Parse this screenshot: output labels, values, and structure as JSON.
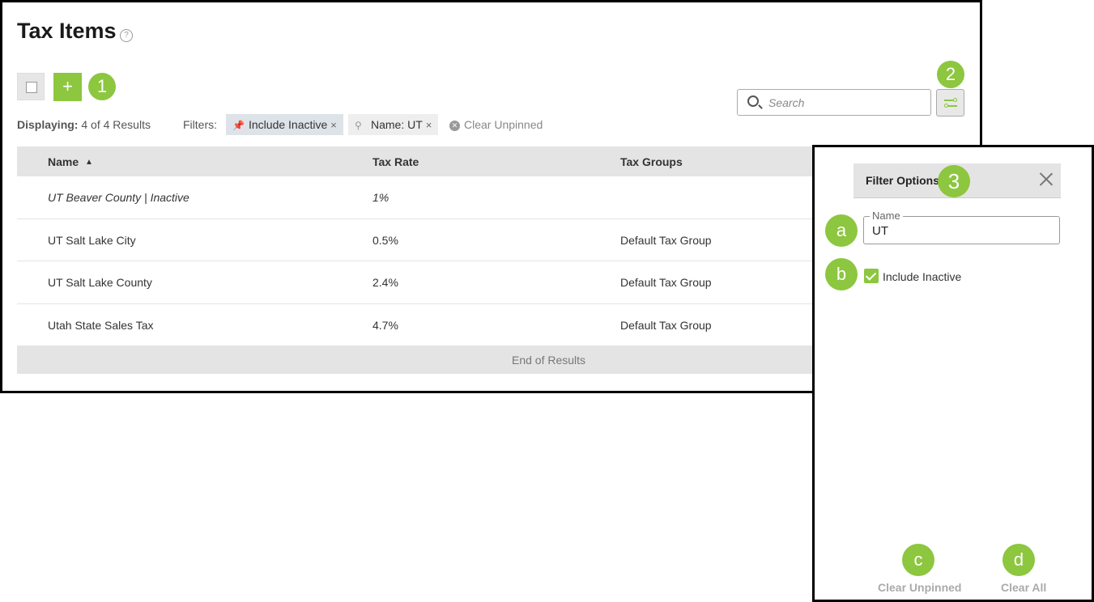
{
  "page": {
    "title": "Tax Items",
    "help": "?"
  },
  "toolbar": {
    "add_label": "+"
  },
  "summary": {
    "label": "Displaying:",
    "value": "4 of 4 Results"
  },
  "filters": {
    "label": "Filters:",
    "chips": [
      {
        "text": "Include Inactive",
        "pinned": true,
        "remove": "×"
      },
      {
        "text": "Name: UT",
        "pinned": false,
        "remove": "×"
      }
    ],
    "clear_unpinned": "Clear Unpinned"
  },
  "search": {
    "placeholder": "Search"
  },
  "table": {
    "columns": [
      "Name",
      "Tax Rate",
      "Tax Groups"
    ],
    "sort_indicator": "▲",
    "rows": [
      {
        "name": "UT Beaver County | Inactive",
        "rate": "1%",
        "groups": "",
        "inactive": true
      },
      {
        "name": "UT Salt Lake City",
        "rate": "0.5%",
        "groups": "Default Tax Group",
        "inactive": false
      },
      {
        "name": "UT Salt Lake County",
        "rate": "2.4%",
        "groups": "Default Tax Group",
        "inactive": false
      },
      {
        "name": "Utah State Sales Tax",
        "rate": "4.7%",
        "groups": "Default Tax Group",
        "inactive": false
      }
    ],
    "end_text": "End of Results"
  },
  "filter_panel": {
    "title": "Filter Options",
    "name_field": {
      "label": "Name",
      "value": "UT"
    },
    "include_inactive": {
      "label": "Include Inactive",
      "checked": true
    },
    "clear_unpinned": "Clear Unpinned",
    "clear_all": "Clear All"
  },
  "callouts": {
    "one": "1",
    "two": "2",
    "three": "3",
    "a": "a",
    "b": "b",
    "c": "c",
    "d": "d"
  },
  "colors": {
    "accent": "#8dc63f",
    "header_bg": "#e4e4e4",
    "pinned_chip": "#dde3e8"
  }
}
